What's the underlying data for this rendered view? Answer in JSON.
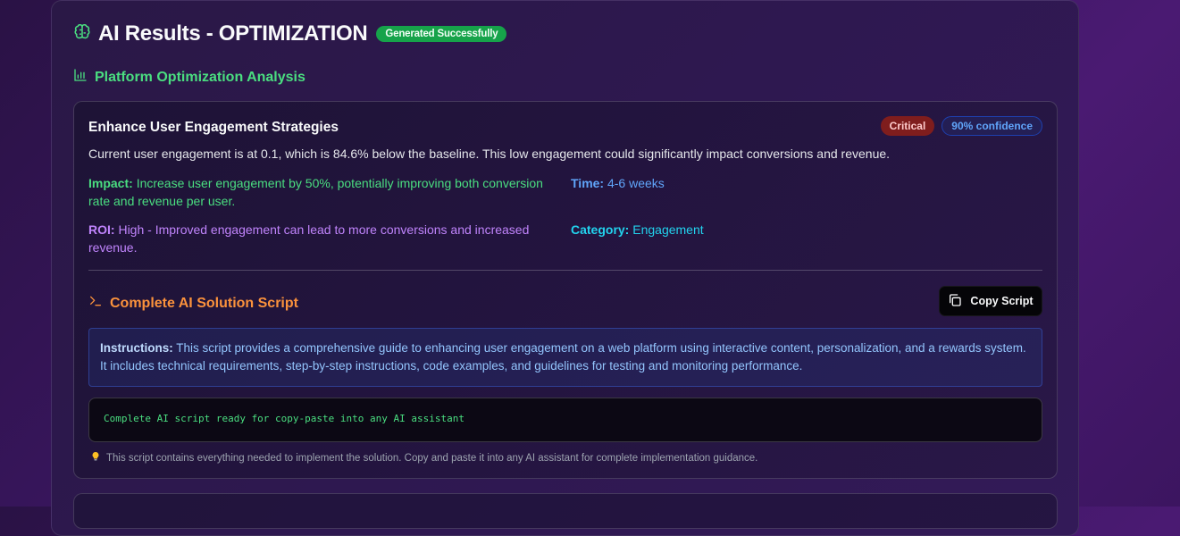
{
  "header": {
    "title": "AI Results - OPTIMIZATION",
    "status_badge": "Generated Successfully",
    "icon": "brain-icon"
  },
  "section": {
    "title": "Platform Optimization Analysis",
    "icon": "bar-chart-icon"
  },
  "recommendation": {
    "title": "Enhance User Engagement Strategies",
    "priority": "Critical",
    "confidence": "90% confidence",
    "description": "Current user engagement is at 0.1, which is 84.6% below the baseline. This low engagement could significantly impact conversions and revenue.",
    "impact_label": "Impact:",
    "impact_value": "Increase user engagement by 50%, potentially improving both conversion rate and revenue per user.",
    "time_label": "Time:",
    "time_value": "4-6 weeks",
    "roi_label": "ROI:",
    "roi_value": "High - Improved engagement can lead to more conversions and increased revenue.",
    "category_label": "Category:",
    "category_value": "Engagement"
  },
  "script": {
    "title": "Complete AI Solution Script",
    "icon": "terminal-icon",
    "copy_label": "Copy Script",
    "instructions_label": "Instructions:",
    "instructions_text": "This script provides a comprehensive guide to enhancing user engagement on a web platform using interactive content, personalization, and a rewards system. It includes technical requirements, step-by-step instructions, code examples, and guidelines for testing and monitoring performance.",
    "code_text": "Complete AI script ready for copy-paste into any AI assistant",
    "tip_text": "This script contains everything needed to implement the solution. Copy and paste it into any AI assistant for complete implementation guidance."
  },
  "colors": {
    "success": "#16a34a",
    "critical": "#7f1d1d",
    "impact": "#4ade80",
    "time": "#60a5fa",
    "roi": "#c084fc",
    "category": "#22d3ee",
    "script_accent": "#fb923c"
  }
}
